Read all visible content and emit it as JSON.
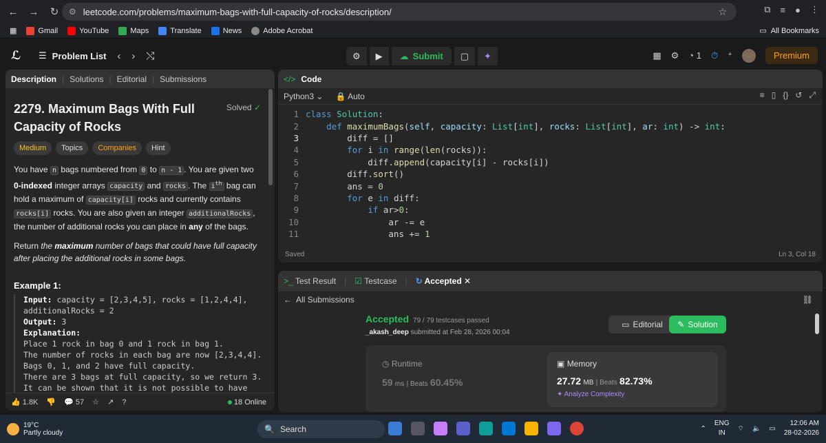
{
  "browser": {
    "url": "leetcode.com/problems/maximum-bags-with-full-capacity-of-rocks/description/",
    "bookmarks": [
      "Gmail",
      "YouTube",
      "Maps",
      "Translate",
      "News",
      "Adobe Acrobat"
    ],
    "all_bookmarks": "All Bookmarks"
  },
  "header": {
    "problem_list": "Problem List",
    "submit": "Submit",
    "streak": "1",
    "premium": "Premium"
  },
  "left": {
    "tabs": [
      "Description",
      "Solutions",
      "Editorial",
      "Submissions"
    ],
    "title": "2279. Maximum Bags With Full Capacity of Rocks",
    "solved": "Solved",
    "tags": [
      "Medium",
      "Topics",
      "Companies",
      "Hint"
    ],
    "example_title": "Example 1:",
    "likes": "1.8K",
    "comments": "57",
    "online": "18 Online"
  },
  "code": {
    "tab": "Code",
    "language": "Python3",
    "mode": "Auto",
    "status": "Saved",
    "cursor": "Ln 3, Col 18"
  },
  "result": {
    "tabs": [
      "Test Result",
      "Testcase",
      "Accepted"
    ],
    "back": "All Submissions",
    "verdict": "Accepted",
    "passed": "79 / 79 testcases passed",
    "user": "_akash_deep",
    "submitted": "submitted at Feb 28, 2026 00:04",
    "editorial": "Editorial",
    "solution": "Solution",
    "runtime_label": "Runtime",
    "runtime_value": "59",
    "runtime_unit": "ms",
    "runtime_beats": "60.45%",
    "memory_label": "Memory",
    "memory_value": "27.72",
    "memory_unit": "MB",
    "memory_beats": "82.73%",
    "beats_label": "Beats",
    "analyze": "Analyze Complexity"
  },
  "taskbar": {
    "temp": "19°C",
    "weather": "Partly cloudy",
    "search": "Search",
    "lang": "ENG",
    "region": "IN",
    "time": "12:06 AM",
    "date": "28-02-2026"
  }
}
